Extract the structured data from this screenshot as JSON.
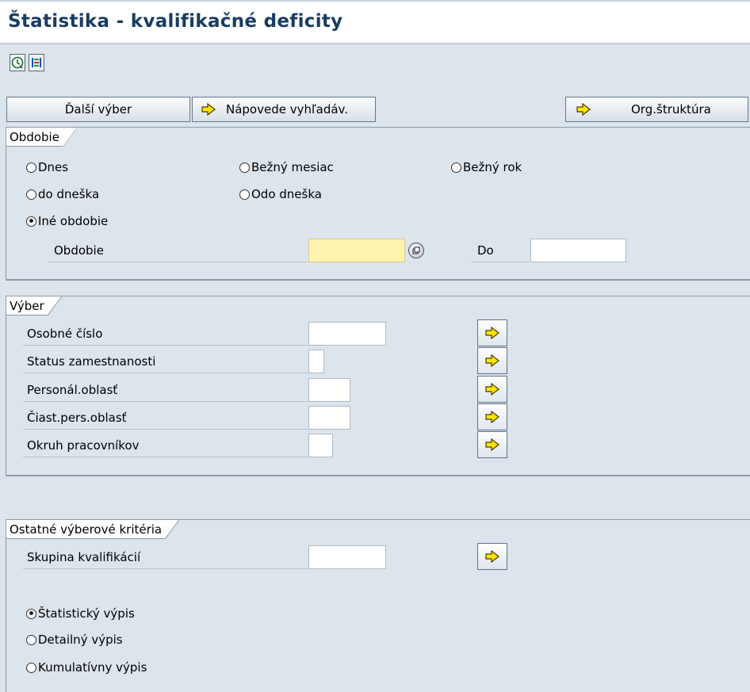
{
  "title": "Štatistika - kvalifikačné deficity",
  "toolbar": {
    "icons": [
      "execute-icon",
      "selection-options-icon"
    ]
  },
  "buttons": {
    "further_selection": "Ďalší výber",
    "search_help": "Nápovede vyhľadáv.",
    "org_structure": "Org.štruktúra"
  },
  "period_group": {
    "title": "Obdobie",
    "radios": {
      "today": "Dnes",
      "current_month": "Bežný mesiac",
      "current_year": "Bežný rok",
      "until_today": "do dneška",
      "from_today": "Odo dneška",
      "other_period": "Iné obdobie"
    },
    "selected": "other_period",
    "period_label": "Obdobie",
    "period_value": "",
    "to_label": "Do",
    "to_value": ""
  },
  "selection_group": {
    "title": "Výber",
    "fields": [
      {
        "label": "Osobné číslo",
        "value": ""
      },
      {
        "label": "Status zamestnanosti",
        "value": ""
      },
      {
        "label": "Personál.oblasť",
        "value": ""
      },
      {
        "label": "Čiast.pers.oblasť",
        "value": ""
      },
      {
        "label": "Okruh pracovníkov",
        "value": ""
      }
    ]
  },
  "other_group": {
    "title": "Ostatné výberové kritéria",
    "qual_group_label": "Skupina kvalifikácií",
    "qual_group_value": "",
    "radios": {
      "statistical": "Štatistický výpis",
      "detailed": "Detailný výpis",
      "cumulative": "Kumulatívny výpis"
    },
    "selected": "statistical"
  },
  "colors": {
    "title": "#1a3c61",
    "background": "#dce4ec",
    "required_field": "#fff3b0",
    "arrow_yellow": "#ffe600"
  }
}
